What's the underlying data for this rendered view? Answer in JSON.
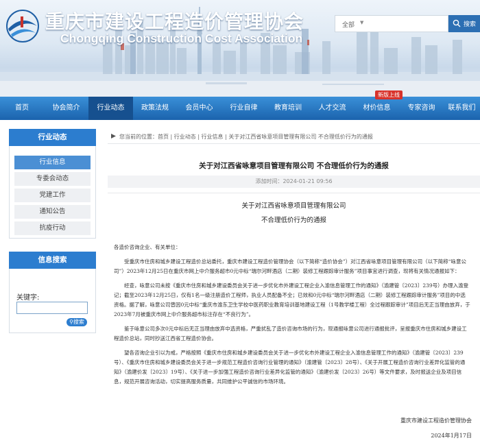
{
  "site": {
    "title_cn": "重庆市建设工程造价管理协会",
    "title_en": "Chongqing Construction Cost Association"
  },
  "search": {
    "scope": "全部",
    "placeholder": "",
    "button_label": "搜索"
  },
  "nav": {
    "items": [
      {
        "label": "首页"
      },
      {
        "label": "协会简介"
      },
      {
        "label": "行业动态"
      },
      {
        "label": "政策法规"
      },
      {
        "label": "会员中心"
      },
      {
        "label": "行业自律"
      },
      {
        "label": "教育培训"
      },
      {
        "label": "人才交流"
      },
      {
        "label": "材价信息"
      },
      {
        "label": "专家咨询"
      },
      {
        "label": "联系我们"
      }
    ],
    "active_label": "行业动态",
    "badge": "新版上线"
  },
  "sidebar": {
    "title": "行业动态",
    "items": [
      {
        "label": "行业信息"
      },
      {
        "label": "专委会动态"
      },
      {
        "label": "党建工作"
      },
      {
        "label": "通知公告"
      },
      {
        "label": "抗疫行动"
      }
    ],
    "active_label": "行业信息"
  },
  "info_search": {
    "title": "信息搜索",
    "keyword_label": "关键字:",
    "keyword_value": "",
    "button_label": "搜索"
  },
  "breadcrumb": {
    "text": "您当前的位置：首页 | 行业动态 | 行业信息 | 关于对江西省咏意项目管理有限公司 不合理低价行为的通报"
  },
  "article": {
    "title": "关于对江西省咏意项目管理有限公司 不合理低价行为的通报",
    "meta": "添加时间：2024-01-21 09:56",
    "doc_title_line1": "关于对江西省咏意项目管理有限公司",
    "doc_title_line2": "不合理低价行为的通报",
    "salutation": "各造价咨询企业、有关单位：",
    "paragraphs": [
      "受重庆市住房和城乡建设工程造价总站委托，重庆市建设工程造价管理协会（以下简称“造价协会”）对江西省咏意项目管理有限公司（以下简称“咏意公司”）2023年12月25日在重庆市网上中介服务超市0元中标“瑞尔河畔酒店（二期）装修工程跟踪审计服务”项目事宜进行调查，现将有关情况通报如下：",
      "经查，咏意公司未按《重庆市住房和城乡建设委员会关于进一步优化市外建设工程企业入渝信息管理工作的通知》（渝建管〔2023〕239号）办理入渝登记；截至2023年12月25日，仅有1名一级注册造价工程师，执业人员配备不全；已效和0元中标“瑞尔河畔酒店（二期）装修工程跟踪审计服务”项目的中选资格。据了解，咏意公司曾因0元中标“重庆市渝东卫生学校中医药职业教育培训基地建设工程（1号教学楼工程）全过程跟踪审计”项目后无正当理由放弃，于2023年7月被重庆市网上中介服务超市标注存在“不良行为”。",
      "鉴于咏意公司多次0元中标后无正当理由放弃中选资格，严重扰乱了造价咨询市场的行为，现通报咏意公司进行通报批评，呈报重庆市住房和城乡建设工程造价总站，同时抄送江西省工程造价协会。",
      "望各咨询企业引以为戒，严格按照《重庆市住房和城乡建设委员会关于进一步优化市外建设工程企业入渝信息管理工作的通知》（渝建管〔2023〕239号）、《重庆市住房和城乡建设委员会关于进一步规范工程造价咨询行业管理的通知》（渝建管〔2023〕28号）、《关于开展工程造价咨询行业差异化监管的通知》（渝建价发〔2023〕19号）、《关于进一步加强工程造价咨询行业差异化监管的通知》（渝建价发〔2023〕26号）等文件要求，及时报送企业及项目信息，规范开展咨询活动，切实提高服务质量，共同维护公平诚信的市场环境。"
    ],
    "sign_org": "重庆市建设工程造价管理协会",
    "sign_date": "2024年1月17日"
  },
  "colors": {
    "nav_blue": "#2a78c6",
    "nav_active": "#16508f",
    "panel_blue": "#2c7dcf",
    "badge_red": "#d8322b"
  }
}
